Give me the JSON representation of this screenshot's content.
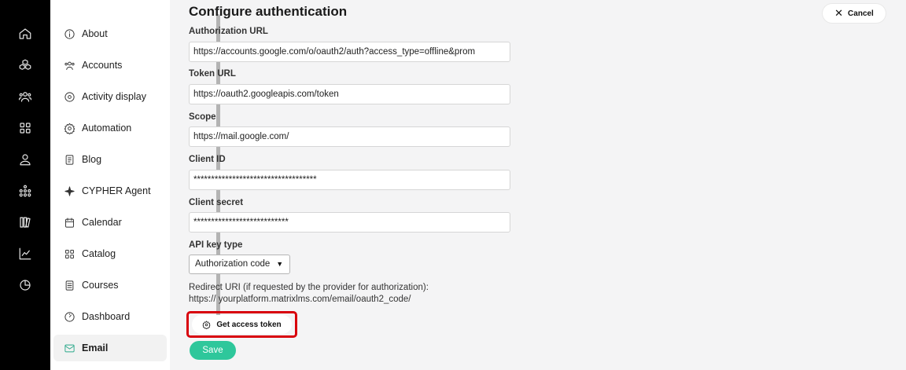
{
  "rail": {
    "icons": [
      "home-icon",
      "cubes-icon",
      "users-icon",
      "grid-icon",
      "user-icon",
      "hierarchy-icon",
      "library-icon",
      "chart-line-icon",
      "pie-chart-icon"
    ]
  },
  "sidebar": {
    "items": [
      {
        "label": "About",
        "icon": "info-icon"
      },
      {
        "label": "Accounts",
        "icon": "accounts-icon"
      },
      {
        "label": "Activity display",
        "icon": "target-icon"
      },
      {
        "label": "Automation",
        "icon": "gear-icon"
      },
      {
        "label": "Blog",
        "icon": "document-icon"
      },
      {
        "label": "CYPHER Agent",
        "icon": "sparkle-icon"
      },
      {
        "label": "Calendar",
        "icon": "calendar-icon"
      },
      {
        "label": "Catalog",
        "icon": "grid-icon"
      },
      {
        "label": "Courses",
        "icon": "list-icon"
      },
      {
        "label": "Dashboard",
        "icon": "gauge-icon"
      },
      {
        "label": "Email",
        "icon": "mail-icon",
        "active": true
      }
    ]
  },
  "main": {
    "title": "Configure authentication",
    "cancel_label": "Cancel",
    "auth_url": {
      "label": "Authorization URL",
      "value": "https://accounts.google.com/o/oauth2/auth?access_type=offline&prom"
    },
    "token_url": {
      "label": "Token URL",
      "value": "https://oauth2.googleapis.com/token"
    },
    "scope": {
      "label": "Scope",
      "value": "https://mail.google.com/"
    },
    "client_id": {
      "label": "Client ID",
      "value": "***********************************"
    },
    "client_secret": {
      "label": "Client secret",
      "value": "***************************"
    },
    "api_key_type": {
      "label": "API key type",
      "value": "Authorization code"
    },
    "redirect": {
      "label": "Redirect URI (if requested by the provider for authorization):",
      "value": "https:// yourplatform.matrixlms.com/email/oauth2_code/"
    },
    "get_token_label": "Get access token",
    "save_label": "Save"
  },
  "colors": {
    "rail_bg": "#000000",
    "accent": "#2ec79b",
    "highlight": "#d8000c"
  }
}
